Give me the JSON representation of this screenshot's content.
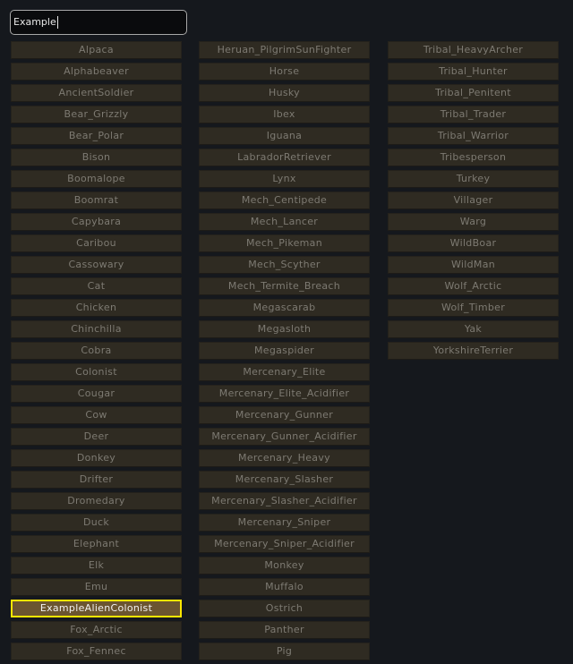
{
  "search": {
    "value": "Example"
  },
  "selected": "ExampleAlienColonist",
  "columns": [
    [
      "Alpaca",
      "Alphabeaver",
      "AncientSoldier",
      "Bear_Grizzly",
      "Bear_Polar",
      "Bison",
      "Boomalope",
      "Boomrat",
      "Capybara",
      "Caribou",
      "Cassowary",
      "Cat",
      "Chicken",
      "Chinchilla",
      "Cobra",
      "Colonist",
      "Cougar",
      "Cow",
      "Deer",
      "Donkey",
      "Drifter",
      "Dromedary",
      "Duck",
      "Elephant",
      "Elk",
      "Emu",
      "ExampleAlienColonist",
      "Fox_Arctic",
      "Fox_Fennec"
    ],
    [
      "Heruan_PilgrimSunFighter",
      "Horse",
      "Husky",
      "Ibex",
      "Iguana",
      "LabradorRetriever",
      "Lynx",
      "Mech_Centipede",
      "Mech_Lancer",
      "Mech_Pikeman",
      "Mech_Scyther",
      "Mech_Termite_Breach",
      "Megascarab",
      "Megasloth",
      "Megaspider",
      "Mercenary_Elite",
      "Mercenary_Elite_Acidifier",
      "Mercenary_Gunner",
      "Mercenary_Gunner_Acidifier",
      "Mercenary_Heavy",
      "Mercenary_Slasher",
      "Mercenary_Slasher_Acidifier",
      "Mercenary_Sniper",
      "Mercenary_Sniper_Acidifier",
      "Monkey",
      "Muffalo",
      "Ostrich",
      "Panther",
      "Pig"
    ],
    [
      "Tribal_HeavyArcher",
      "Tribal_Hunter",
      "Tribal_Penitent",
      "Tribal_Trader",
      "Tribal_Warrior",
      "Tribesperson",
      "Turkey",
      "Villager",
      "Warg",
      "WildBoar",
      "WildMan",
      "Wolf_Arctic",
      "Wolf_Timber",
      "Yak",
      "YorkshireTerrier"
    ]
  ],
  "colors": {
    "background": "#15181d",
    "button": "#2f2b22",
    "button_text": "#7d7a72",
    "selected_bg": "#6b5530",
    "selected_border": "#ffe600"
  }
}
